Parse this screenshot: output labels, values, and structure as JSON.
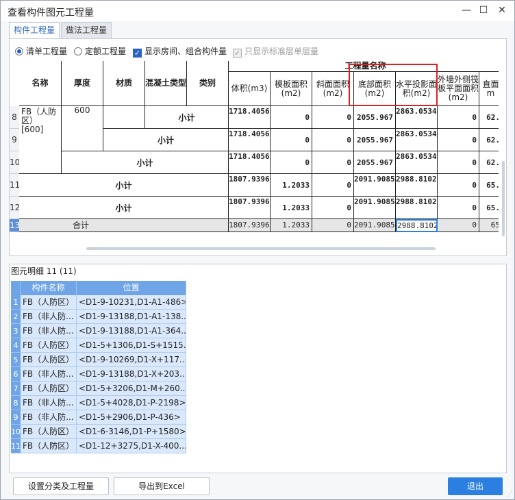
{
  "window": {
    "title": "查看构件图元工程量",
    "minimize": "—",
    "maximize": "☐",
    "close": "✕"
  },
  "tabs": [
    {
      "label": "构件工程量"
    },
    {
      "label": "做法工程量"
    }
  ],
  "options": {
    "radio_list": "清单工程量",
    "radio_quota": "定额工程量",
    "chk_room": "显示房间、组合构件量",
    "chk_std": "只显示标准层单层量",
    "check_mark": "✓"
  },
  "grid": {
    "headers": {
      "name": "名称",
      "thickness": "厚度",
      "material": "材质",
      "concrete": "混凝土类型",
      "category": "类别",
      "group": "工程量名称",
      "volume": "体积(m3)",
      "formwork": "模板面积(m2)",
      "slope": "斜面面积(m2)",
      "bottom": "底部面积(m2)",
      "projection": "水平投影面积(m2)",
      "outer": "外墙外侧筏板平面面积(m2)",
      "side": "直面m"
    },
    "fb_name": "FB（人防区）[600]",
    "fb_thick": "600",
    "subtotal": "小计",
    "total": "合计",
    "rows": [
      {
        "rn": "8",
        "volume": "1718.4056",
        "formwork": "0",
        "slope": "0",
        "bottom": "2055.967",
        "projection": "2863.0534",
        "outer": "0",
        "side": "62."
      },
      {
        "rn": "9",
        "volume": "1718.4056",
        "formwork": "0",
        "slope": "0",
        "bottom": "2055.967",
        "projection": "2863.0534",
        "outer": "0",
        "side": "62."
      },
      {
        "rn": "10",
        "volume": "1718.4056",
        "formwork": "0",
        "slope": "0",
        "bottom": "2055.967",
        "projection": "2863.0534",
        "outer": "0",
        "side": "62."
      },
      {
        "rn": "11",
        "volume": "1807.9396",
        "formwork": "1.2033",
        "slope": "0",
        "bottom": "2091.9085",
        "projection": "2988.8102",
        "outer": "0",
        "side": "65."
      },
      {
        "rn": "12",
        "volume": "1807.9396",
        "formwork": "1.2033",
        "slope": "0",
        "bottom": "2091.9085",
        "projection": "2988.8102",
        "outer": "0",
        "side": "65."
      },
      {
        "rn": "13",
        "volume": "1807.9396",
        "formwork": "1.2033",
        "slope": "0",
        "bottom": "2091.9085",
        "projection": "2988.8102",
        "outer": "0",
        "side": "65"
      }
    ]
  },
  "detail": {
    "title": "图元明细  11 (11)",
    "col_name": "构件名称",
    "col_pos": "位置",
    "rows": [
      {
        "rn": "1",
        "name": "FB（人防区）",
        "pos": "<D1-9-10231,D1-A1-486>"
      },
      {
        "rn": "2",
        "name": "FB（非人防...",
        "pos": "<D1-9-13188,D1-A1-138..."
      },
      {
        "rn": "3",
        "name": "FB（非人防...",
        "pos": "<D1-9-13188,D1-A1-364..."
      },
      {
        "rn": "4",
        "name": "FB（人防区）",
        "pos": "<D1-5+1306,D1-S+1515..."
      },
      {
        "rn": "5",
        "name": "FB（人防区）",
        "pos": "<D1-9-10269,D1-X+117..."
      },
      {
        "rn": "6",
        "name": "FB（非人防...",
        "pos": "<D1-9-13188,D1-X+203..."
      },
      {
        "rn": "7",
        "name": "FB（人防区）",
        "pos": "<D1-5+3206,D1-M+260..."
      },
      {
        "rn": "8",
        "name": "FB（非人防...",
        "pos": "<D1-5+4028,D1-P-2198>"
      },
      {
        "rn": "9",
        "name": "FB（非人防...",
        "pos": "<D1-5+2906,D1-P-436>"
      },
      {
        "rn": "10",
        "name": "FB（人防区）",
        "pos": "<D1-6-3146,D1-P+1580>"
      },
      {
        "rn": "11",
        "name": "FB（人防区）",
        "pos": "<D1-12+3275,D1-X-400..."
      }
    ]
  },
  "buttons": {
    "settings": "设置分类及工程量",
    "export": "导出到Excel",
    "exit": "退出"
  },
  "colors": {
    "accent": "#2a7fe0",
    "highlight": "#e02020",
    "detail_header": "#6fa5e6"
  }
}
